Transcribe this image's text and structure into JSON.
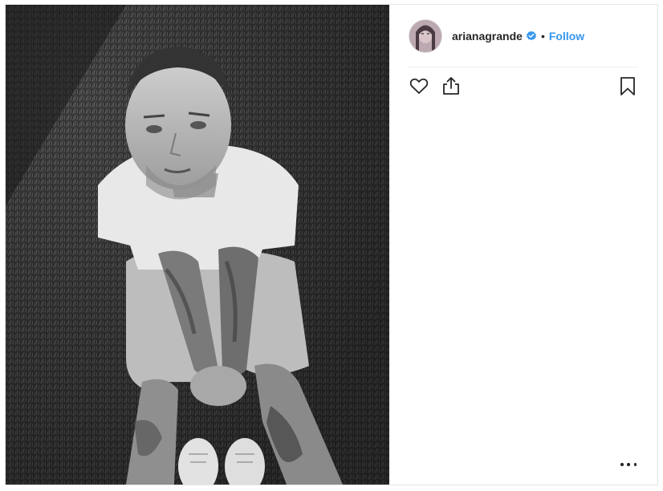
{
  "post": {
    "author": {
      "username": "arianagrande",
      "verified": true,
      "follow_label": "Follow",
      "separator": "•"
    },
    "photo": {
      "subject": "grayscale photo"
    },
    "actions": {
      "like_icon": "heart-icon",
      "share_icon": "share-icon",
      "save_icon": "bookmark-icon",
      "more_icon": "more-options-icon"
    },
    "colors": {
      "link": "#3897f0",
      "text": "#262626",
      "verified_badge": "#3897f0"
    }
  }
}
